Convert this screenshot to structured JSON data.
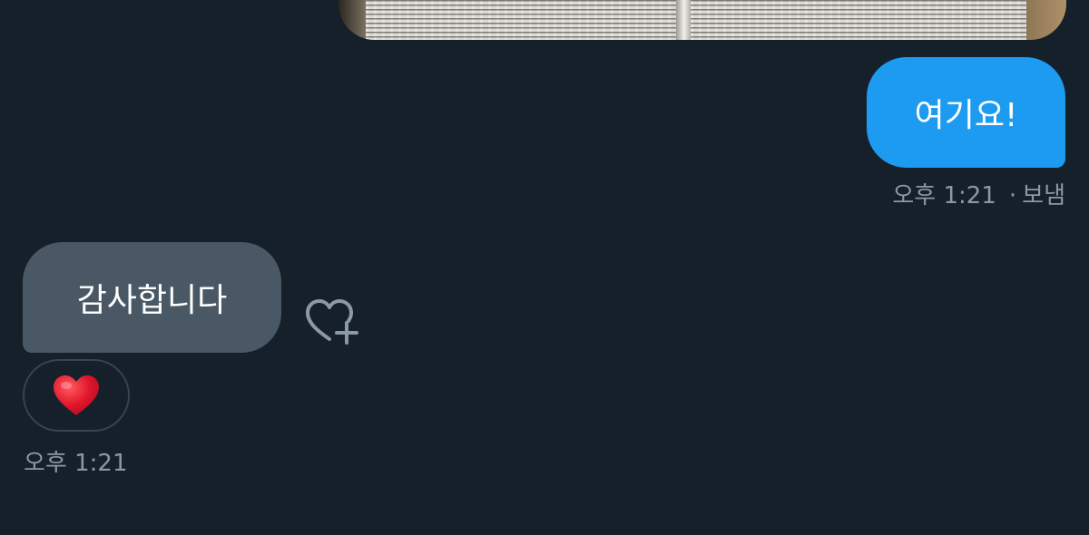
{
  "conversation": {
    "sent_message": {
      "text": "여기요!",
      "time": "오후 1:21",
      "status": "보냄",
      "separator": "·"
    },
    "received_message": {
      "text": "감사합니다",
      "time": "오후 1:21",
      "reaction": "heart"
    },
    "attachment": {
      "kind": "photo"
    }
  },
  "icons": {
    "reaction_add": "heart-plus-icon",
    "reaction": "red-heart-icon"
  },
  "colors": {
    "background": "#15202b",
    "sent_bubble": "#1d9bf0",
    "received_bubble": "#4a5866",
    "meta_text": "#8b98a5",
    "heart": "#e0162b"
  }
}
